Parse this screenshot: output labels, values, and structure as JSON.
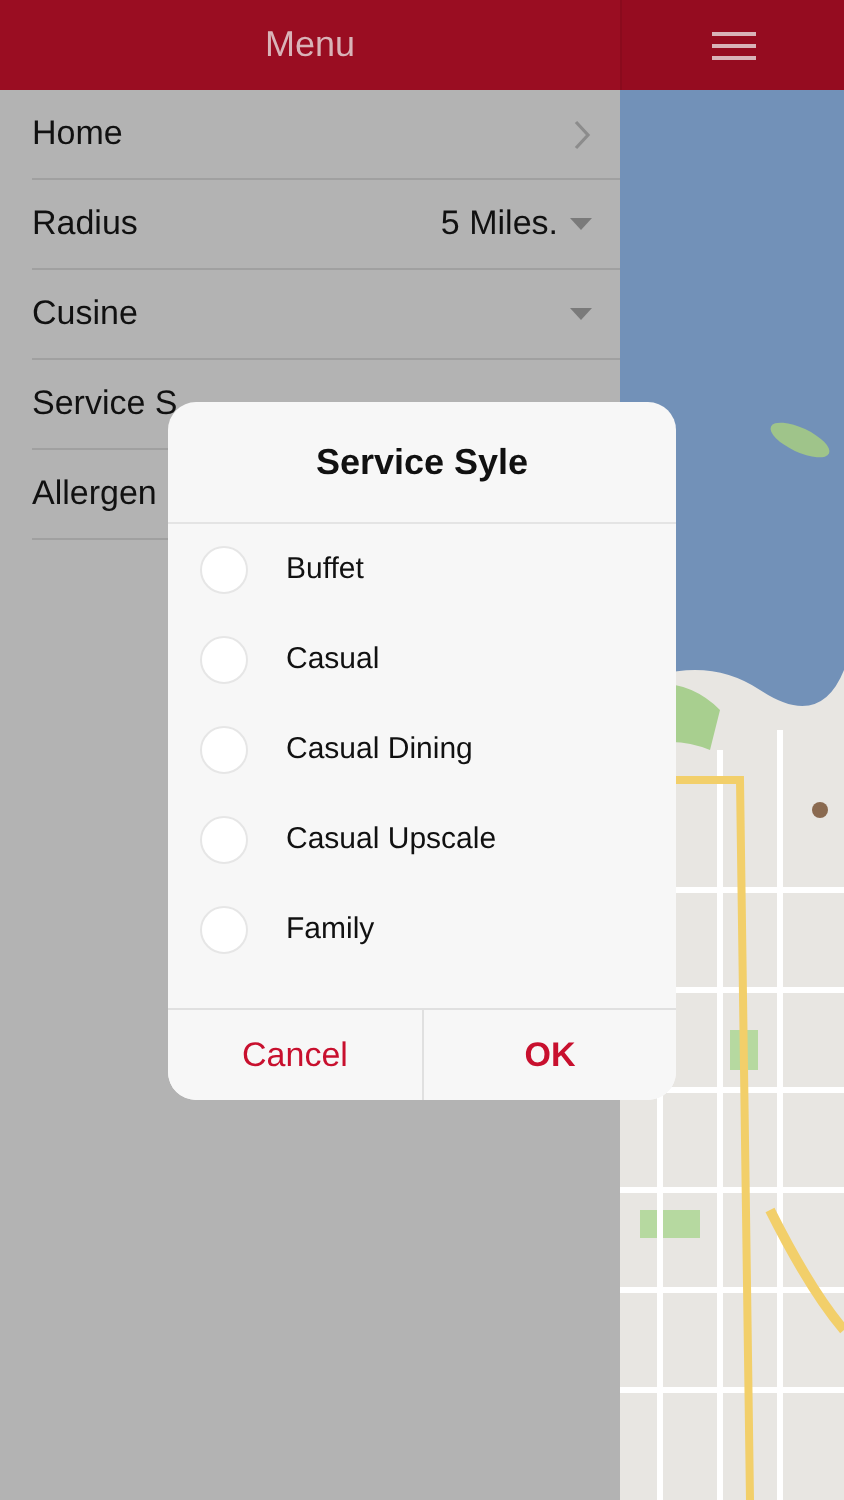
{
  "header": {
    "title": "Menu"
  },
  "menu_items": [
    {
      "label": "Home",
      "kind": "link"
    },
    {
      "label": "Radius",
      "kind": "dropdown",
      "value": "5 Miles."
    },
    {
      "label": "Cusine",
      "kind": "dropdown"
    },
    {
      "label": "Service S",
      "kind": "plain"
    },
    {
      "label": "Allergen",
      "kind": "plain"
    }
  ],
  "dialog": {
    "title": "Service Syle",
    "options": [
      {
        "label": "Buffet",
        "selected": false
      },
      {
        "label": "Casual",
        "selected": false
      },
      {
        "label": "Casual Dining",
        "selected": false
      },
      {
        "label": "Casual Upscale",
        "selected": false
      },
      {
        "label": "Family",
        "selected": false
      }
    ],
    "buttons": [
      {
        "label": "Cancel",
        "kind": "secondary"
      },
      {
        "label": "OK",
        "kind": "primary"
      }
    ]
  }
}
